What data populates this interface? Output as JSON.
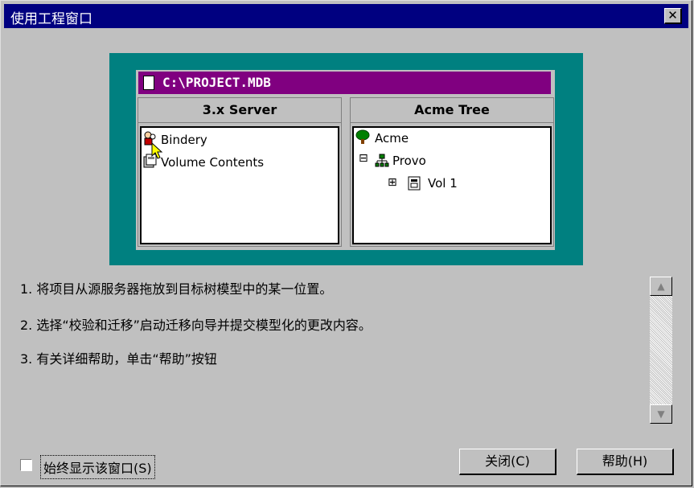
{
  "window": {
    "title": "使用工程窗口",
    "close_glyph": "✕"
  },
  "illustration": {
    "path": "C:\\PROJECT.MDB",
    "left_pane": {
      "header": "3.x Server",
      "items": [
        "Bindery",
        "Volume Contents"
      ]
    },
    "right_pane": {
      "header": "Acme Tree",
      "root": "Acme",
      "child": "Provo",
      "grandchild": "Vol 1",
      "expanded_glyph": "⊟",
      "collapsed_glyph": "⊞"
    },
    "colors": {
      "frame": "#008080",
      "pathbar": "#800080"
    }
  },
  "steps": [
    "1.  将项目从源服务器拖放到目标树模型中的某一位置。",
    "2.  选择“校验和迁移”启动迁移向导并提交模型化的更改内容。",
    "3.  有关详细帮助，单击“帮助”按钮"
  ],
  "scrollbar": {
    "up_glyph": "▲",
    "down_glyph": "▼"
  },
  "footer": {
    "checkbox_label": "始终显示该窗口(S)",
    "checkbox_checked": false,
    "close_button": "关闭(C)",
    "help_button": "帮助(H)"
  }
}
